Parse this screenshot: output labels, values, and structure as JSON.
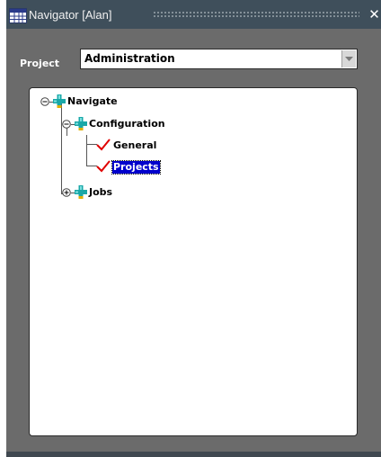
{
  "window": {
    "title": "Navigator [Alan]",
    "close_glyph": "✕",
    "app_icon": "grid-app-icon",
    "close_icon": "close-icon"
  },
  "project": {
    "label": "Project",
    "value": "Administration"
  },
  "tree": {
    "root": {
      "label": "Navigate",
      "expanded": true
    },
    "configuration": {
      "label": "Configuration",
      "expanded": true
    },
    "general": {
      "label": "General"
    },
    "projects": {
      "label": "Projects",
      "selected": true
    },
    "jobs": {
      "label": "Jobs",
      "expanded": false
    }
  },
  "colors": {
    "titlebar": "#3f4f5b",
    "body": "#6b6b6b",
    "selection": "#0000cc",
    "plus_icon": "#1aa8a8",
    "check": "#e00000"
  }
}
